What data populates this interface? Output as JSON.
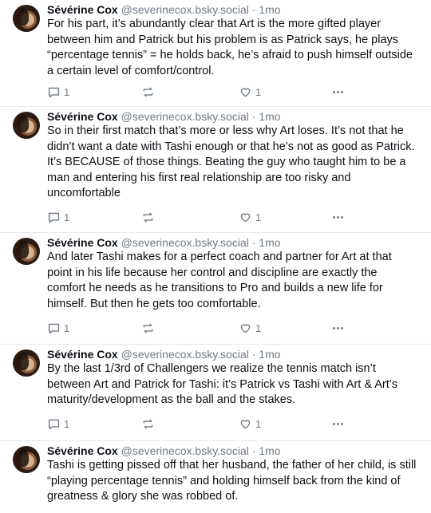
{
  "posts": [
    {
      "author": "Sévérine Cox",
      "handle": "@severinecox.bsky.social",
      "time": "1mo",
      "text": "For his part, it’s abundantly clear that Art is the more gifted player between him and Patrick but his problem is as Patrick says, he plays “percentage tennis” = he holds back, he’s afraid to push himself outside a certain level of comfort/control.",
      "replies": "1",
      "reposts": "",
      "likes": "1"
    },
    {
      "author": "Sévérine Cox",
      "handle": "@severinecox.bsky.social",
      "time": "1mo",
      "text": "So in their first match that’s more or less why Art loses. It’s not that he didn’t want a date with Tashi enough or that he’s not as good as Patrick. It’s BECAUSE of those things. Beating the guy who taught him to be a man and entering his first real relationship are too risky and uncomfortable",
      "replies": "1",
      "reposts": "",
      "likes": "1"
    },
    {
      "author": "Sévérine Cox",
      "handle": "@severinecox.bsky.social",
      "time": "1mo",
      "text": "And later Tashi makes for a perfect coach and partner for Art at that point in his life because her control and discipline are exactly the comfort he needs as he transitions to Pro and builds a new life for himself. But then he gets too comfortable.",
      "replies": "1",
      "reposts": "",
      "likes": "1"
    },
    {
      "author": "Sévérine Cox",
      "handle": "@severinecox.bsky.social",
      "time": "1mo",
      "text": "By the last 1/3rd of Challengers we realize the tennis match isn’t between Art and Patrick for Tashi: it’s Patrick vs Tashi with Art & Art’s maturity/development as the ball and the stakes.",
      "replies": "1",
      "reposts": "",
      "likes": "1"
    },
    {
      "author": "Sévérine Cox",
      "handle": "@severinecox.bsky.social",
      "time": "1mo",
      "text": "Tashi is getting pissed off that her husband, the father of her child, is still “playing percentage tennis” and holding himself back from the kind of greatness & glory she was robbed of.",
      "replies": "",
      "reposts": "",
      "likes": ""
    }
  ],
  "separator": "·",
  "icons": {
    "reply": "reply-bubble-icon",
    "repost": "repost-arrows-icon",
    "like": "heart-icon",
    "more": "more-dots-icon"
  },
  "colors": {
    "text": "#0b0f14",
    "muted": "#6f7a86",
    "divider": "#e6e9ee"
  }
}
